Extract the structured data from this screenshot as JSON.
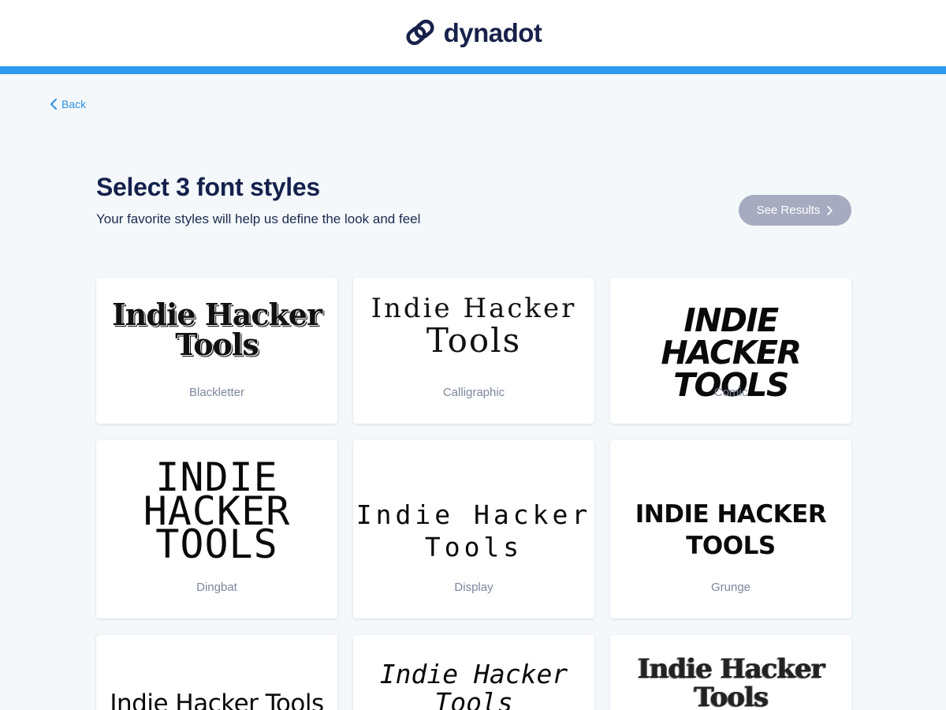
{
  "header": {
    "logo_text": "dynadot",
    "accent_color": "#2e97ee",
    "logo_color": "#17214a"
  },
  "nav": {
    "back_label": "Back",
    "back_icon": "chevron-left-icon"
  },
  "page": {
    "title": "Select 3 font styles",
    "subtitle": "Your favorite styles will help us define the look and feel",
    "see_results_label": "See Results",
    "see_results_icon": "chevron-right-icon"
  },
  "cards": [
    {
      "sample_line1": "Indie Hacker",
      "sample_line2": "Tools",
      "label": "Blackletter"
    },
    {
      "sample_line1": "Indie Hacker",
      "sample_line2": "Tools",
      "label": "Calligraphic"
    },
    {
      "sample_line1": "Indie Hacker",
      "sample_line2": "Tools",
      "label": "Comic"
    },
    {
      "sample_line1": "INDIE",
      "sample_line2": "HACKER",
      "sample_line3": "TOOLS",
      "label": "Dingbat"
    },
    {
      "sample_line1": "Indie Hacker",
      "sample_line2": "Tools",
      "label": "Display"
    },
    {
      "sample_line1": "Indie Hacker",
      "sample_line2": "Tools",
      "label": "Grunge"
    },
    {
      "sample_line1": "Indie Hacker Tools"
    },
    {
      "sample_line1": "Indie Hacker",
      "sample_line2": "Tools"
    },
    {
      "sample_line1": "Indie Hacker",
      "sample_line2": "Tools"
    }
  ]
}
